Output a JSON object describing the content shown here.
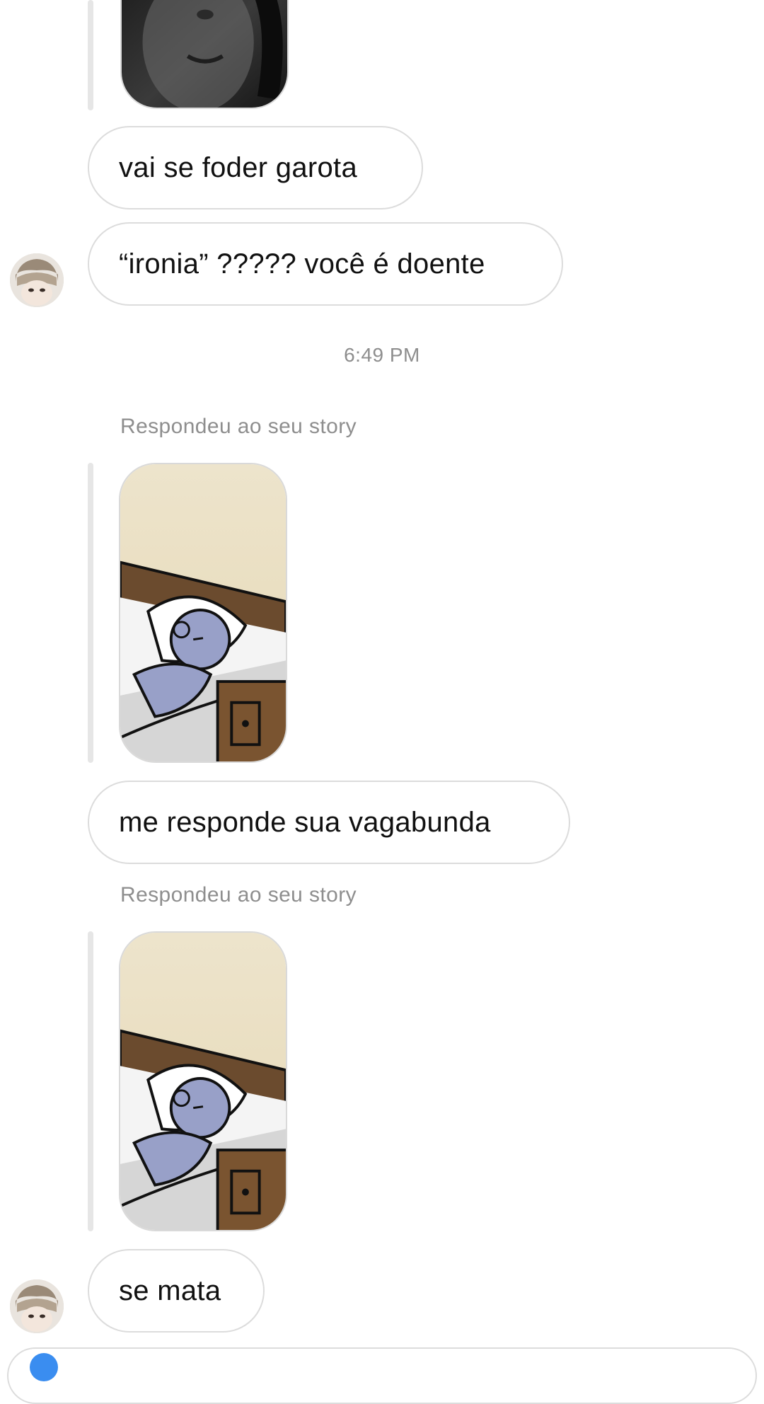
{
  "thread": {
    "messages": [
      {
        "text": "vai se foder garota"
      },
      {
        "text": "“ironia” ????? você é doente"
      },
      {
        "text": "me responde sua vagabunda"
      },
      {
        "text": "se mata"
      }
    ],
    "timestamp": "6:49 PM",
    "story_reply_label": "Respondeu ao seu story"
  },
  "icons": {
    "avatar": "avatar-photo",
    "story": "story-image",
    "composer": "camera-icon"
  },
  "colors": {
    "bubble_border": "#dcdcdc",
    "secondary_text": "#8e8e8e",
    "reply_bar": "#e6e6e6",
    "composer_accent": "#3a8df0"
  }
}
